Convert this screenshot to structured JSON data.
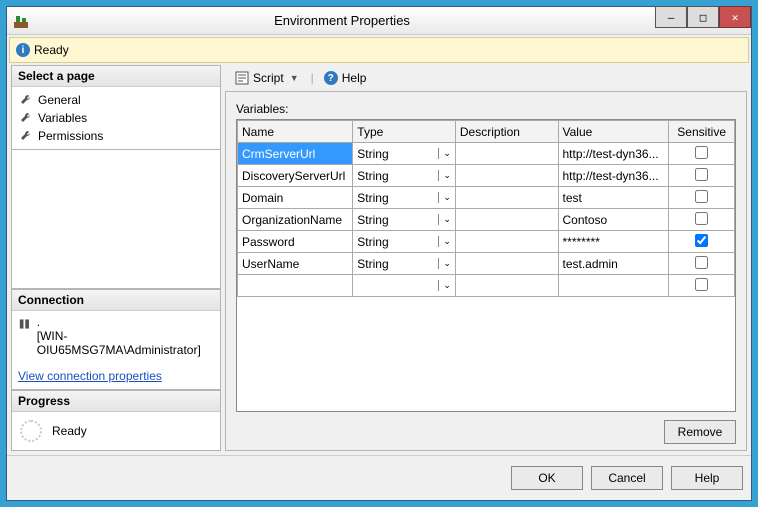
{
  "window": {
    "title": "Environment Properties"
  },
  "status": {
    "text": "Ready"
  },
  "sidebar": {
    "pages_header": "Select a page",
    "pages": [
      "General",
      "Variables",
      "Permissions"
    ],
    "connection_header": "Connection",
    "connection_server": ".",
    "connection_user": "[WIN-OIU65MSG7MA\\Administrator]",
    "connection_link": "View connection properties",
    "progress_header": "Progress",
    "progress_text": "Ready"
  },
  "toolbar": {
    "script_label": "Script",
    "help_label": "Help"
  },
  "grid": {
    "label": "Variables:",
    "headers": {
      "name": "Name",
      "type": "Type",
      "description": "Description",
      "value": "Value",
      "sensitive": "Sensitive"
    },
    "rows": [
      {
        "name": "CrmServerUrl",
        "type": "String",
        "description": "",
        "value": "http://test-dyn36...",
        "sensitive": false,
        "selected": true
      },
      {
        "name": "DiscoveryServerUrl",
        "type": "String",
        "description": "",
        "value": "http://test-dyn36...",
        "sensitive": false
      },
      {
        "name": "Domain",
        "type": "String",
        "description": "",
        "value": "test",
        "sensitive": false
      },
      {
        "name": "OrganizationName",
        "type": "String",
        "description": "",
        "value": "Contoso",
        "sensitive": false
      },
      {
        "name": "Password",
        "type": "String",
        "description": "",
        "value": "********",
        "sensitive": true
      },
      {
        "name": "UserName",
        "type": "String",
        "description": "",
        "value": "test.admin",
        "sensitive": false
      },
      {
        "name": "",
        "type": "",
        "description": "",
        "value": "",
        "sensitive": false,
        "blank": true
      }
    ],
    "remove_label": "Remove"
  },
  "footer": {
    "ok": "OK",
    "cancel": "Cancel",
    "help": "Help"
  }
}
